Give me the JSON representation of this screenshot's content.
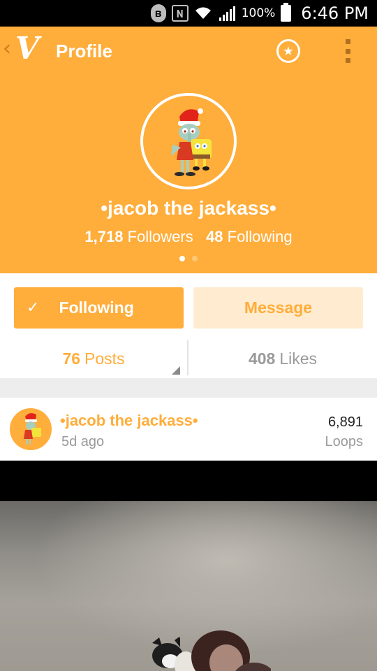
{
  "status_bar": {
    "bluetooth_icon": "bluetooth-icon",
    "nfc_label": "N",
    "wifi_icon": "wifi-icon",
    "signal_icon": "signal-icon",
    "battery_pct": "100%",
    "battery_icon": "battery-icon",
    "time": "6:46 PM"
  },
  "header": {
    "back_icon": "chevron-left-icon",
    "logo": "V",
    "title": "Profile",
    "favorite_icon": "star-icon",
    "menu_icon": "more-vert-icon",
    "username": "•jacob the jackass•",
    "followers_count": "1,718",
    "followers_label": "Followers",
    "following_count": "48",
    "following_label": "Following",
    "page_dots": 2,
    "active_dot": 1
  },
  "actions": {
    "following_label": "Following",
    "check_icon": "✓",
    "message_label": "Message"
  },
  "tabs": {
    "posts_count": "76",
    "posts_label": "Posts",
    "likes_count": "408",
    "likes_label": "Likes"
  },
  "post": {
    "username": "•jacob the jackass•",
    "time": "5d ago",
    "loops_count": "6,891",
    "loops_label": "Loops"
  },
  "colors": {
    "accent": "#ffad3b",
    "message_bg": "#ffecd0",
    "muted_text": "#9a9a9a"
  }
}
